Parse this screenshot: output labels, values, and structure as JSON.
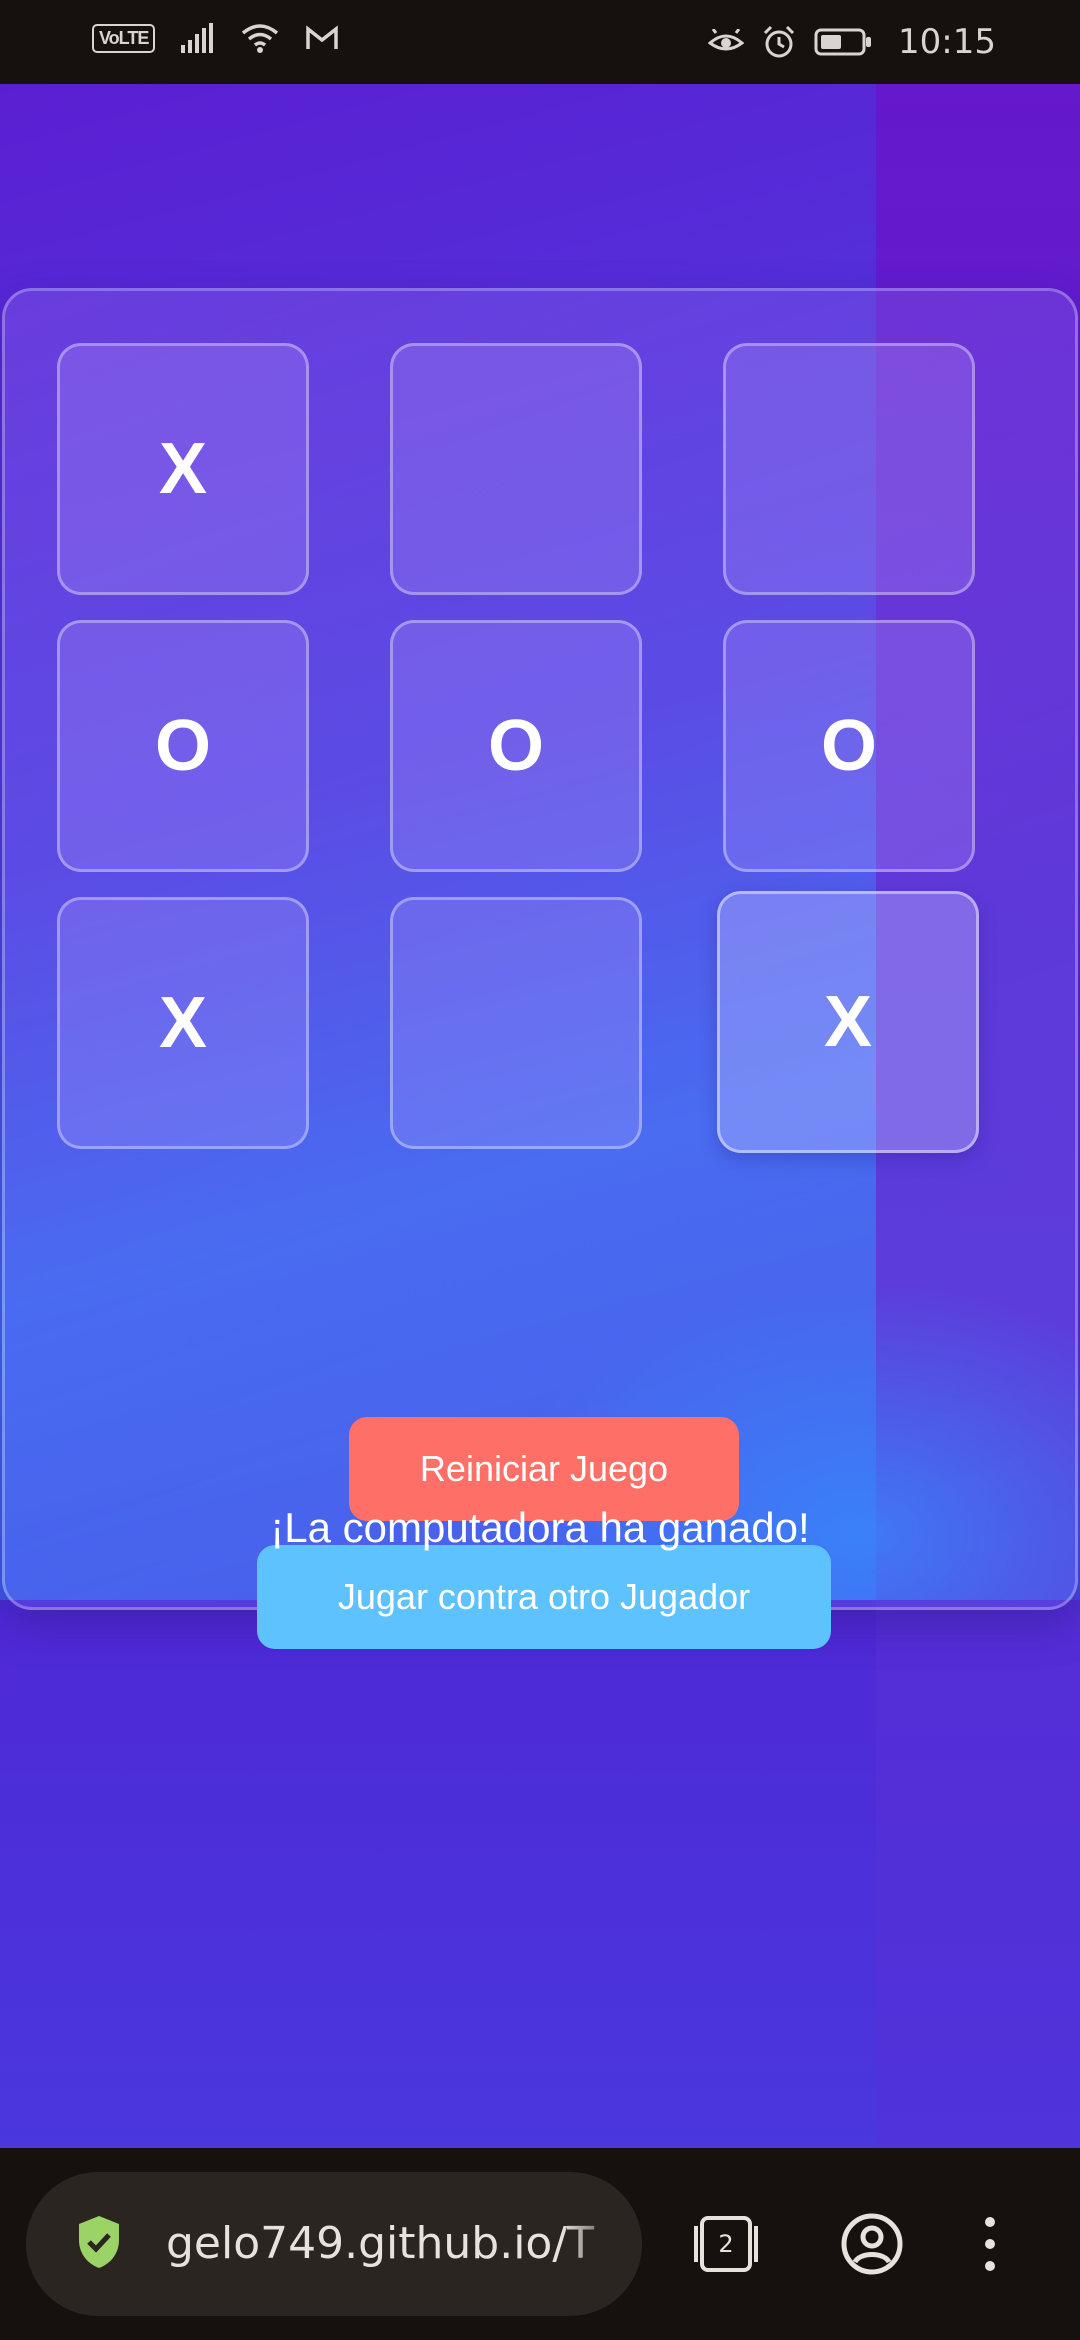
{
  "status_bar": {
    "volte": "VoLTE",
    "time": "10:15",
    "icons": [
      "signal-icon",
      "wifi-icon",
      "gmail-icon",
      "eye-comfort-icon",
      "alarm-icon",
      "battery-icon"
    ]
  },
  "game": {
    "board": [
      "X",
      "",
      "",
      "O",
      "O",
      "O",
      "X",
      "",
      "X"
    ],
    "reset_label": "Reiniciar Juego",
    "pvp_label": "Jugar contra otro Jugador",
    "result_message": "¡La computadora ha ganado!"
  },
  "browser": {
    "url": "gelo749.github.io/T",
    "tab_count": "2",
    "icons": [
      "secure-shield-icon",
      "tab-switcher-icon",
      "account-icon",
      "more-menu-icon"
    ]
  },
  "colors": {
    "reset_button": "#fe6f67",
    "pvp_button": "#5ec2fe",
    "background_top": "#6716cc",
    "background_bottom": "#4240e3"
  }
}
